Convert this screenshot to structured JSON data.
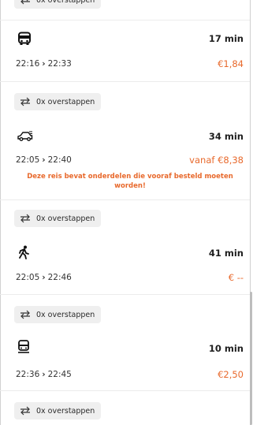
{
  "options": [
    {
      "mode": "bus",
      "icon": "bus-icon",
      "duration": "17 min",
      "depart": "22:16",
      "arrive": "22:33",
      "price": "€1,84",
      "warning": ""
    },
    {
      "mode": "car",
      "icon": "car-icon",
      "duration": "34 min",
      "depart": "22:05",
      "arrive": "22:40",
      "price": "vanaf €8,38",
      "warning": "Deze reis bevat onderdelen die vooraf besteld moeten worden!"
    },
    {
      "mode": "walk",
      "icon": "walking-icon",
      "duration": "41 min",
      "depart": "22:05",
      "arrive": "22:46",
      "price": "€ --",
      "warning": ""
    },
    {
      "mode": "train",
      "icon": "train-icon",
      "duration": "10 min",
      "depart": "22:36",
      "arrive": "22:45",
      "price": "€2,50",
      "warning": ""
    }
  ],
  "transfers_label": "0x overstappen",
  "colors": {
    "accent": "#e8692c",
    "chip_bg": "#efefef",
    "divider": "#ececec"
  }
}
